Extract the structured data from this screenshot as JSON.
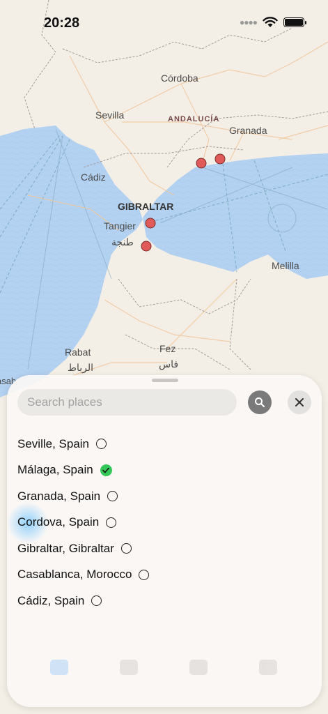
{
  "status": {
    "time": "20:28"
  },
  "map": {
    "labels": {
      "cordoba": "Córdoba",
      "sevilla": "Sevilla",
      "andalucia": "ANDALUCÍA",
      "granada": "Granada",
      "cadiz": "Cádiz",
      "gibraltar": "GIBRALTAR",
      "tangier": "Tangier",
      "tangier_ar": "طنجة",
      "melilla": "Melilla",
      "rabat": "Rabat",
      "rabat_ar": "الرباط",
      "fez": "Fez",
      "fez_ar": "فاس",
      "casablanca_partial": "asab"
    },
    "colors": {
      "land": "#f4efe6",
      "sea": "#b3d1f0",
      "marker": "#e05a5a",
      "road": "#f1c9a0",
      "border": "#a39a9a"
    }
  },
  "search": {
    "placeholder": "Search places",
    "value": ""
  },
  "icons": {
    "search": "magnifier-icon",
    "close": "close-icon",
    "check": "checkmark-icon"
  },
  "places": [
    {
      "label": "Seville, Spain",
      "selected": false
    },
    {
      "label": "Málaga, Spain",
      "selected": true
    },
    {
      "label": "Granada, Spain",
      "selected": false
    },
    {
      "label": "Cordova, Spain",
      "selected": false
    },
    {
      "label": "Gibraltar, Gibraltar",
      "selected": false
    },
    {
      "label": "Casablanca, Morocco",
      "selected": false
    },
    {
      "label": "Cádiz, Spain",
      "selected": false
    }
  ]
}
